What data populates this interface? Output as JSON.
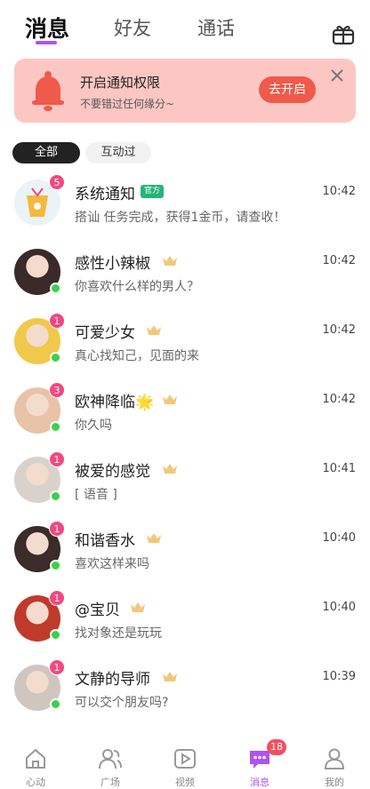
{
  "top_tabs": [
    "消息",
    "好友",
    "通话"
  ],
  "banner": {
    "title": "开启通知权限",
    "subtitle": "不要错过任何缘分~",
    "button": "去开启"
  },
  "filters": [
    "全部",
    "互动过"
  ],
  "conversations": [
    {
      "name": "系统通知",
      "tag": "官方",
      "message": "搭讪 任务完成，获得1金币，请查收！",
      "time": "10:42",
      "badge": "5",
      "online": false,
      "avatar_color": "#e9f3f8"
    },
    {
      "name": "感性小辣椒",
      "message": "你喜欢什么样的男人？",
      "time": "10:42",
      "badge": "",
      "online": true,
      "avatar_color": "#3a2a2a"
    },
    {
      "name": "可爱少女",
      "message": "真心找知己，见面的来",
      "time": "10:42",
      "badge": "1",
      "online": true,
      "avatar_color": "#f0c84a"
    },
    {
      "name": "欧神降临🌟",
      "message": "你久吗",
      "time": "10:42",
      "badge": "3",
      "online": true,
      "avatar_color": "#e8c3a8"
    },
    {
      "name": "被爱的感觉",
      "message": "[ 语音 ]",
      "time": "10:41",
      "badge": "1",
      "online": true,
      "avatar_color": "#d9d2cc"
    },
    {
      "name": "和谐香水",
      "message": "喜欢这样来吗",
      "time": "10:40",
      "badge": "1",
      "online": true,
      "avatar_color": "#3b2b2b"
    },
    {
      "name": "@宝贝",
      "message": "找对象还是玩玩",
      "time": "10:40",
      "badge": "1",
      "online": true,
      "avatar_color": "#c03a2c"
    },
    {
      "name": "文静的导师",
      "message": "可以交个朋友吗?",
      "time": "10:39",
      "badge": "1",
      "online": true,
      "avatar_color": "#cfc6c0"
    }
  ],
  "bottom_nav": [
    {
      "label": "心动",
      "icon": "home-icon"
    },
    {
      "label": "广场",
      "icon": "people-icon"
    },
    {
      "label": "视频",
      "icon": "play-icon"
    },
    {
      "label": "消息",
      "icon": "message-icon",
      "badge": "18"
    },
    {
      "label": "我的",
      "icon": "profile-icon"
    }
  ],
  "colors": {
    "accent": "#b152f0",
    "banner_bg": "#fcc7c3",
    "banner_button": "#f05a4a",
    "badge": "#f2477f",
    "online": "#3ad14a",
    "official": "#23b477"
  }
}
